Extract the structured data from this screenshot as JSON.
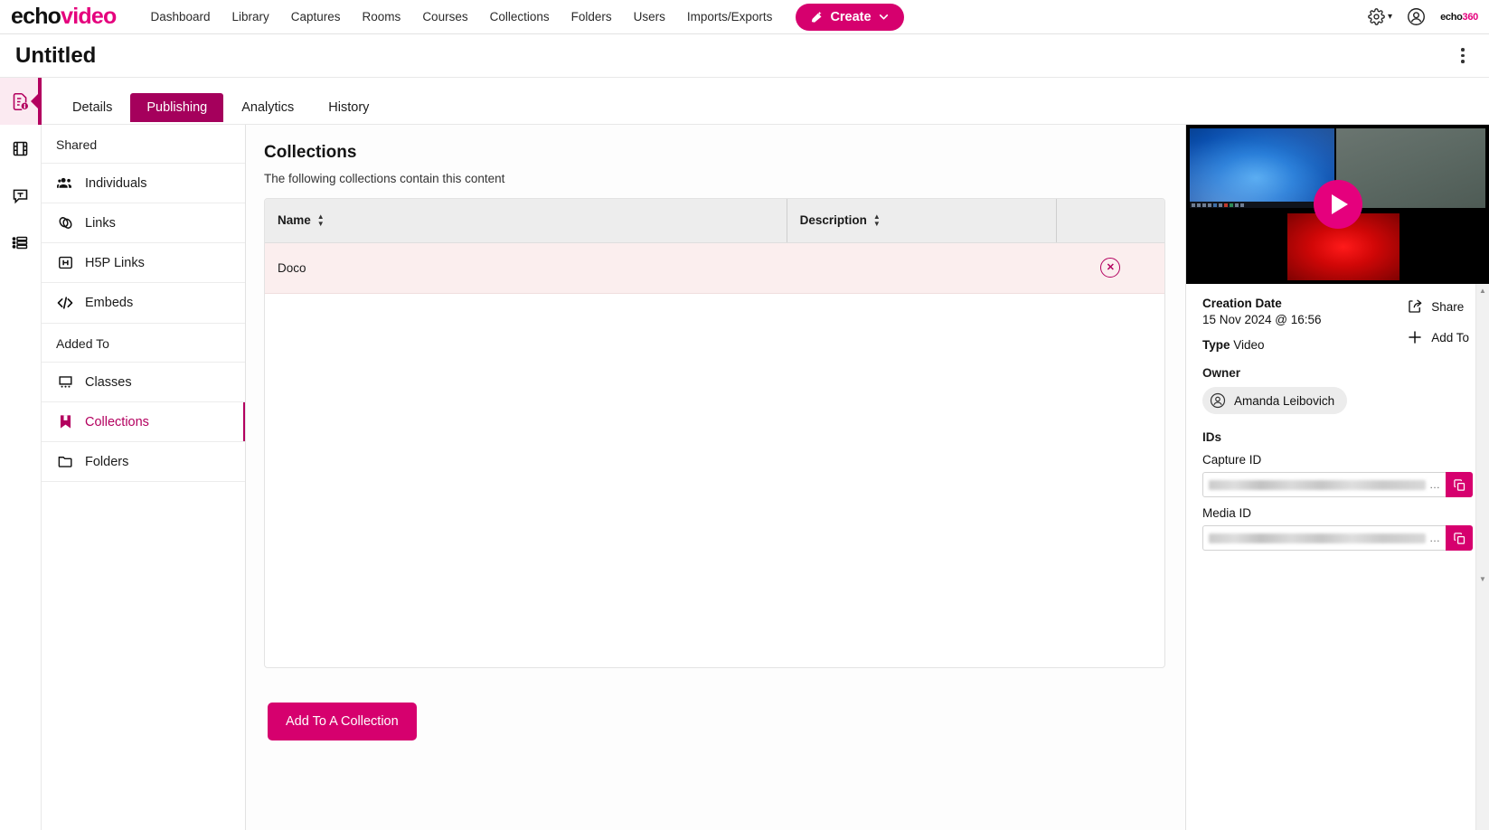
{
  "topnav": {
    "brand": {
      "part1": "echo",
      "part2": "video"
    },
    "links": [
      {
        "label": "Dashboard"
      },
      {
        "label": "Library"
      },
      {
        "label": "Captures"
      },
      {
        "label": "Rooms"
      },
      {
        "label": "Courses"
      },
      {
        "label": "Collections"
      },
      {
        "label": "Folders"
      },
      {
        "label": "Users"
      },
      {
        "label": "Imports/Exports"
      }
    ],
    "create_label": "Create",
    "create_caret": "∨",
    "settings_caret": "▾",
    "brand_small": {
      "part1": "echo",
      "part2": "360"
    },
    "accent": "#d6006e"
  },
  "titlebar": {
    "title": "Untitled",
    "menu_name": "more-options"
  },
  "rail": {
    "items": [
      {
        "name": "details-info",
        "active": true
      },
      {
        "name": "media-clips",
        "active": false
      },
      {
        "name": "transcript",
        "active": false
      },
      {
        "name": "chapters",
        "active": false
      }
    ]
  },
  "tabs": [
    {
      "label": "Details",
      "active": false
    },
    {
      "label": "Publishing",
      "active": true
    },
    {
      "label": "Analytics",
      "active": false
    },
    {
      "label": "History",
      "active": false
    }
  ],
  "sidebar": {
    "groups": [
      {
        "label": "Shared",
        "items": [
          {
            "label": "Individuals",
            "icon": "people-icon",
            "active": false
          },
          {
            "label": "Links",
            "icon": "link-icon",
            "active": false
          },
          {
            "label": "H5P Links",
            "icon": "h5p-icon",
            "active": false
          },
          {
            "label": "Embeds",
            "icon": "code-icon",
            "active": false
          }
        ]
      },
      {
        "label": "Added To",
        "items": [
          {
            "label": "Classes",
            "icon": "classroom-icon",
            "active": false
          },
          {
            "label": "Collections",
            "icon": "bookmark-icon",
            "active": true
          },
          {
            "label": "Folders",
            "icon": "folder-icon",
            "active": false
          }
        ]
      }
    ]
  },
  "main": {
    "heading": "Collections",
    "subheading": "The following collections contain this content",
    "table": {
      "columns": [
        {
          "label": "Name",
          "sortable": true
        },
        {
          "label": "Description",
          "sortable": true
        },
        {
          "label": "",
          "sortable": false
        }
      ],
      "rows": [
        {
          "name": "Doco",
          "description": "",
          "action": "remove",
          "highlighted": true
        }
      ]
    },
    "cta_label": "Add To A Collection"
  },
  "annotation": {
    "type": "arrow",
    "color": "#fa4b42",
    "points_to": "remove-from-collection-button"
  },
  "rightpanel": {
    "creation_date_label": "Creation Date",
    "creation_date_value": "15 Nov 2024 @ 16:56",
    "type_label": "Type",
    "type_value": "Video",
    "owner_label": "Owner",
    "owner_value": "Amanda Leibovich",
    "share_label": "Share",
    "add_to_label": "Add To",
    "ids_label": "IDs",
    "capture_id_label": "Capture ID",
    "capture_id_value": "",
    "media_id_label": "Media ID",
    "media_id_value": "",
    "ellipsis": "…"
  }
}
